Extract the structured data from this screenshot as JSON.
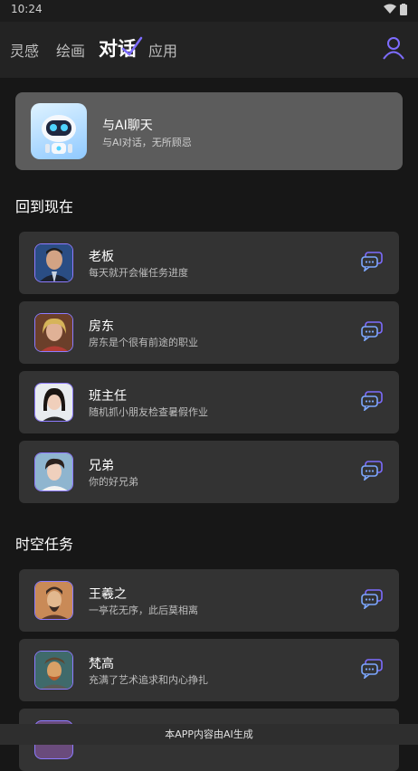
{
  "status": {
    "time": "10:24"
  },
  "tabs": [
    {
      "label": "灵感"
    },
    {
      "label": "绘画"
    },
    {
      "label": "对话"
    },
    {
      "label": "应用"
    }
  ],
  "hero": {
    "title": "与AI聊天",
    "subtitle": "与AI对话，无所顾忌"
  },
  "sections": [
    {
      "title": "回到现在",
      "items": [
        {
          "name": "老板",
          "desc": "每天就开会催任务进度"
        },
        {
          "name": "房东",
          "desc": "房东是个很有前途的职业"
        },
        {
          "name": "班主任",
          "desc": "随机抓小朋友检查暑假作业"
        },
        {
          "name": "兄弟",
          "desc": "你的好兄弟"
        }
      ]
    },
    {
      "title": "时空任务",
      "items": [
        {
          "name": "王羲之",
          "desc": "一亭花无序，此后莫相离"
        },
        {
          "name": "梵高",
          "desc": "充满了艺术追求和内心挣扎"
        }
      ]
    }
  ],
  "footer": "本APP内容由AI生成",
  "colors": {
    "accent": "#7d6cff",
    "card": "#333333",
    "hero": "#5c5c5c"
  }
}
